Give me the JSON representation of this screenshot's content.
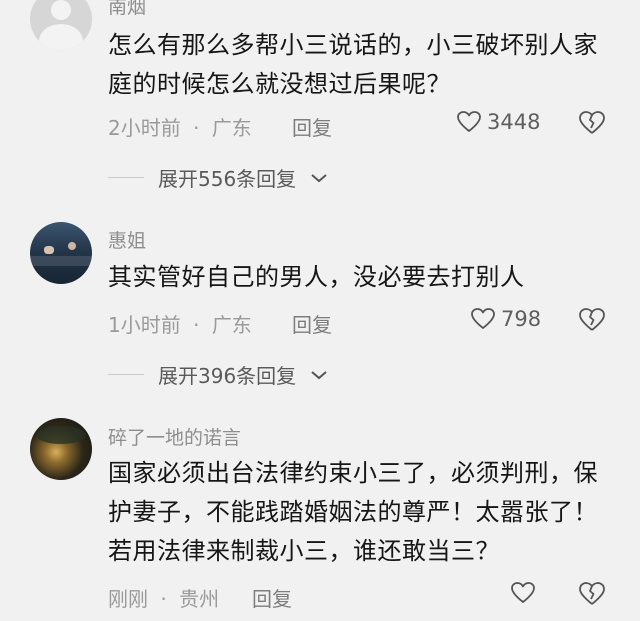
{
  "comments": [
    {
      "username": "南烟",
      "content": "怎么有那么多帮小三说话的，小三破坏别人家庭的时候怎么就没想过后果呢？",
      "time": "2小时前",
      "location": "广东",
      "reply_label": "回复",
      "likes": "3448",
      "expand_label": "展开556条回复"
    },
    {
      "username": "惠姐",
      "content": "其实管好自己的男人，没必要去打别人",
      "time": "1小时前",
      "location": "广东",
      "reply_label": "回复",
      "likes": "798",
      "expand_label": "展开396条回复"
    },
    {
      "username": "碎了一地的诺言",
      "content": "国家必须出台法律约束小三了，必须判刑，保护妻子，不能践踏婚姻法的尊严！太嚣张了！若用法律来制裁小三，谁还敢当三？",
      "time": "刚刚",
      "location": "贵州",
      "reply_label": "回复",
      "likes": ""
    }
  ],
  "meta_separator": "·",
  "icons": [
    "avatar-placeholder-icon",
    "heart-icon",
    "broken-heart-icon",
    "chevron-down-icon"
  ]
}
